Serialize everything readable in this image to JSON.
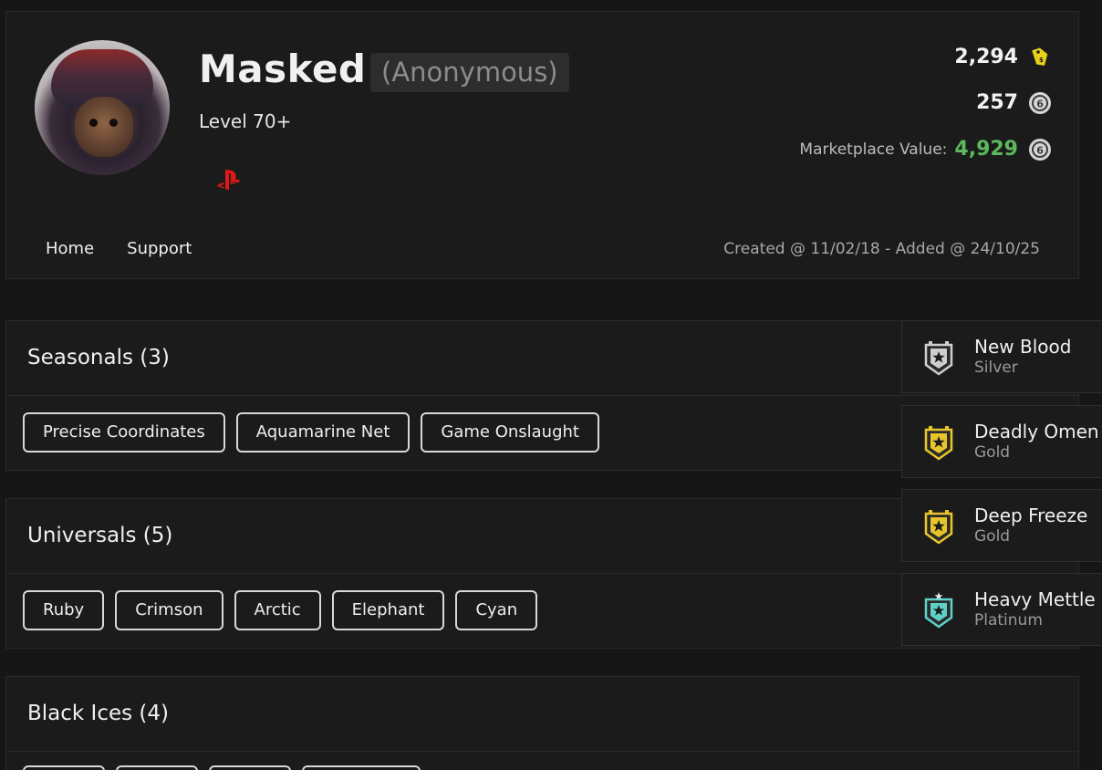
{
  "profile": {
    "name": "Masked",
    "anonymous_tag": "(Anonymous)",
    "level": "Level 70+",
    "platform_icon": "playstation-icon",
    "credits": "2,294",
    "credits_icon": "tag-icon",
    "renown": "257",
    "renown_icon": "r6-credits-icon",
    "marketplace_label": "Marketplace Value:",
    "marketplace_value": "4,929",
    "marketplace_icon": "r6-credits-icon",
    "created": "Created @ 11/02/18 - Added @ 24/10/25",
    "accent_green": "#5cb85c"
  },
  "nav": {
    "home": "Home",
    "support": "Support"
  },
  "sections": {
    "seasonals": {
      "title": "Seasonals (3)",
      "items": [
        "Precise Coordinates",
        "Aquamarine Net",
        "Game Onslaught"
      ]
    },
    "universals": {
      "title": "Universals (5)",
      "items": [
        "Ruby",
        "Crimson",
        "Arctic",
        "Elephant",
        "Cyan"
      ]
    },
    "blackices": {
      "title": "Black Ices (4)"
    }
  },
  "achievements": [
    {
      "title": "New Blood",
      "tier": "Silver",
      "color": "#cfcfcf"
    },
    {
      "title": "Deadly Omen",
      "tier": "Gold",
      "color": "#e8c62a"
    },
    {
      "title": "Deep Freeze",
      "tier": "Gold",
      "color": "#e8c62a"
    },
    {
      "title": "Heavy Mettle",
      "tier": "Platinum",
      "color": "#5fd1c9"
    }
  ]
}
